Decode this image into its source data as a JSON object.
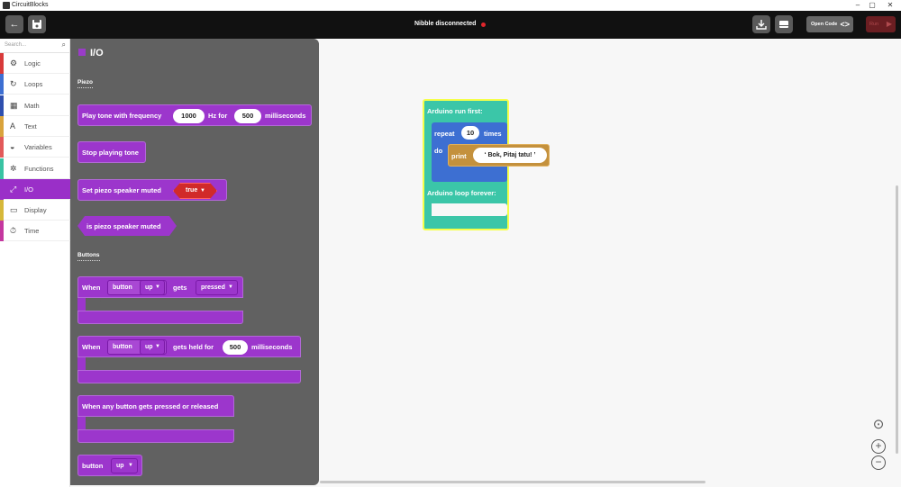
{
  "window": {
    "title": "CircuitBlocks",
    "minimize": "–",
    "maximize": "▢",
    "close": "✕"
  },
  "toolbar": {
    "back_icon": "arrow-left-icon",
    "save_icon": "save-icon",
    "status_text": "Nibble disconnected",
    "status_color": "#e0262c",
    "download_icon": "download-icon",
    "monitor_icon": "serial-monitor-icon",
    "open_code_label": "Open Code",
    "run_label": "Run"
  },
  "sidebar": {
    "search_placeholder": "Search...",
    "categories": [
      {
        "label": "Logic",
        "color": "#d83a3a",
        "icon": "⚙"
      },
      {
        "label": "Loops",
        "color": "#3d6fd2",
        "icon": "↻"
      },
      {
        "label": "Math",
        "color": "#2e4fae",
        "icon": "▦"
      },
      {
        "label": "Text",
        "color": "#d9a33c",
        "icon": "A"
      },
      {
        "label": "Variables",
        "color": "#e25a5a",
        "icon": "◒"
      },
      {
        "label": "Functions",
        "color": "#39c3a3",
        "icon": "✲"
      },
      {
        "label": "I/O",
        "color": "#9a2fc8",
        "icon": "⤢"
      },
      {
        "label": "Display",
        "color": "#d6b83a",
        "icon": "▭"
      },
      {
        "label": "Time",
        "color": "#c4379f",
        "icon": "⏱"
      }
    ]
  },
  "flyout": {
    "title": "I/O",
    "sections": {
      "piezo": "Piezo",
      "buttons": "Buttons"
    },
    "blocks": {
      "play_tone_a": "Play tone with frequency",
      "play_tone_freq": "1000",
      "play_tone_b": "Hz for",
      "play_tone_dur": "500",
      "play_tone_c": "milliseconds",
      "stop_tone": "Stop playing tone",
      "set_muted": "Set piezo speaker muted",
      "set_muted_value": "true",
      "is_muted": "is piezo speaker muted",
      "when_a": "When",
      "when_button": "button",
      "when_dir": "up",
      "when_gets": "gets",
      "when_state": "pressed",
      "held_a": "When",
      "held_button": "button",
      "held_dir": "up",
      "held_b": "gets held for",
      "held_value": "500",
      "held_c": "milliseconds",
      "any_button": "When any button gets pressed or released",
      "btn_label": "button",
      "btn_dir": "up"
    }
  },
  "workspace": {
    "run_first": "Arduino run first:",
    "repeat": "repeat",
    "repeat_count": "10",
    "times": "times",
    "do": "do",
    "print": "print",
    "print_text": "Bok, Pitaj tatu!",
    "loop_forever": "Arduino loop forever:"
  },
  "zoom": {
    "center": "⊙",
    "plus": "+",
    "minus": "−"
  }
}
